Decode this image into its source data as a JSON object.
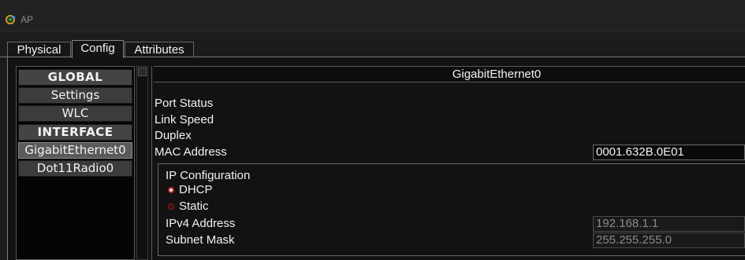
{
  "window": {
    "title": "AP",
    "app_icon": "packet-tracer-icon"
  },
  "tabs": [
    {
      "label": "Physical"
    },
    {
      "label": "Config",
      "active": true
    },
    {
      "label": "Attributes"
    }
  ],
  "sidebar": {
    "items": [
      {
        "label": "GLOBAL",
        "kind": "header"
      },
      {
        "label": "Settings",
        "kind": "item"
      },
      {
        "label": "WLC",
        "kind": "item"
      },
      {
        "label": "INTERFACE",
        "kind": "header"
      },
      {
        "label": "GigabitEthernet0",
        "kind": "item",
        "selected": true
      },
      {
        "label": "Dot11Radio0",
        "kind": "item"
      }
    ]
  },
  "interface": {
    "title": "GigabitEthernet0",
    "port_status_label": "Port Status",
    "link_speed_label": "Link Speed",
    "duplex_label": "Duplex",
    "mac_label": "MAC Address",
    "mac_value": "0001.632B.0E01",
    "ip_config": {
      "legend": "IP Configuration",
      "dhcp_label": "DHCP",
      "dhcp_selected": true,
      "static_label": "Static",
      "ipv4_label": "IPv4 Address",
      "ipv4_value": "192.168.1.1",
      "subnet_label": "Subnet Mask",
      "subnet_value": "255.255.255.0"
    }
  },
  "colors": {
    "radio_accent": "#c02020",
    "background": "#1c1c1c"
  }
}
